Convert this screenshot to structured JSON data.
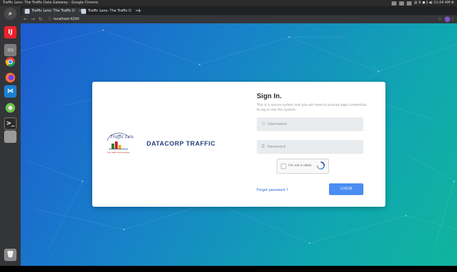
{
  "system": {
    "window_title": "Traffic Lens- The Traffic Data Gateway - Google Chrome",
    "tray_text": "▤ ⇅ ◼ ⟬ ◀) 11:04 AM ⚙"
  },
  "launcher": {
    "icons": [
      "search-icon",
      "intellij-icon",
      "files-icon",
      "chrome-icon",
      "firefox-icon",
      "vscode-icon",
      "network-icon",
      "terminal-icon",
      "drive-icon",
      "trash-icon"
    ]
  },
  "browser": {
    "tabs": [
      {
        "label": "Traffic Lens- The Traffic D",
        "close": "×"
      },
      {
        "label": "Traffic Lens- The Traffic D",
        "close": "×"
      }
    ],
    "new_tab": "+",
    "url": "localhost:4200"
  },
  "card": {
    "logo_text": "Traffic Lens",
    "logo_tagline": "The Traffic Data Gateway",
    "brand_name": "DATACORP TRAFFIC",
    "title": "Sign In.",
    "intro": "This is a secure system and you will need to provide login credentials to log in into the system.",
    "username_placeholder": "Username",
    "password_placeholder": "Password",
    "captcha_label": "I'm not a robot",
    "forgot_password": "Forgot password ?",
    "login_button": "LOGIN"
  },
  "colors": {
    "accent": "#4b8df2",
    "brand": "#233a78",
    "link": "#1f5fd6"
  }
}
